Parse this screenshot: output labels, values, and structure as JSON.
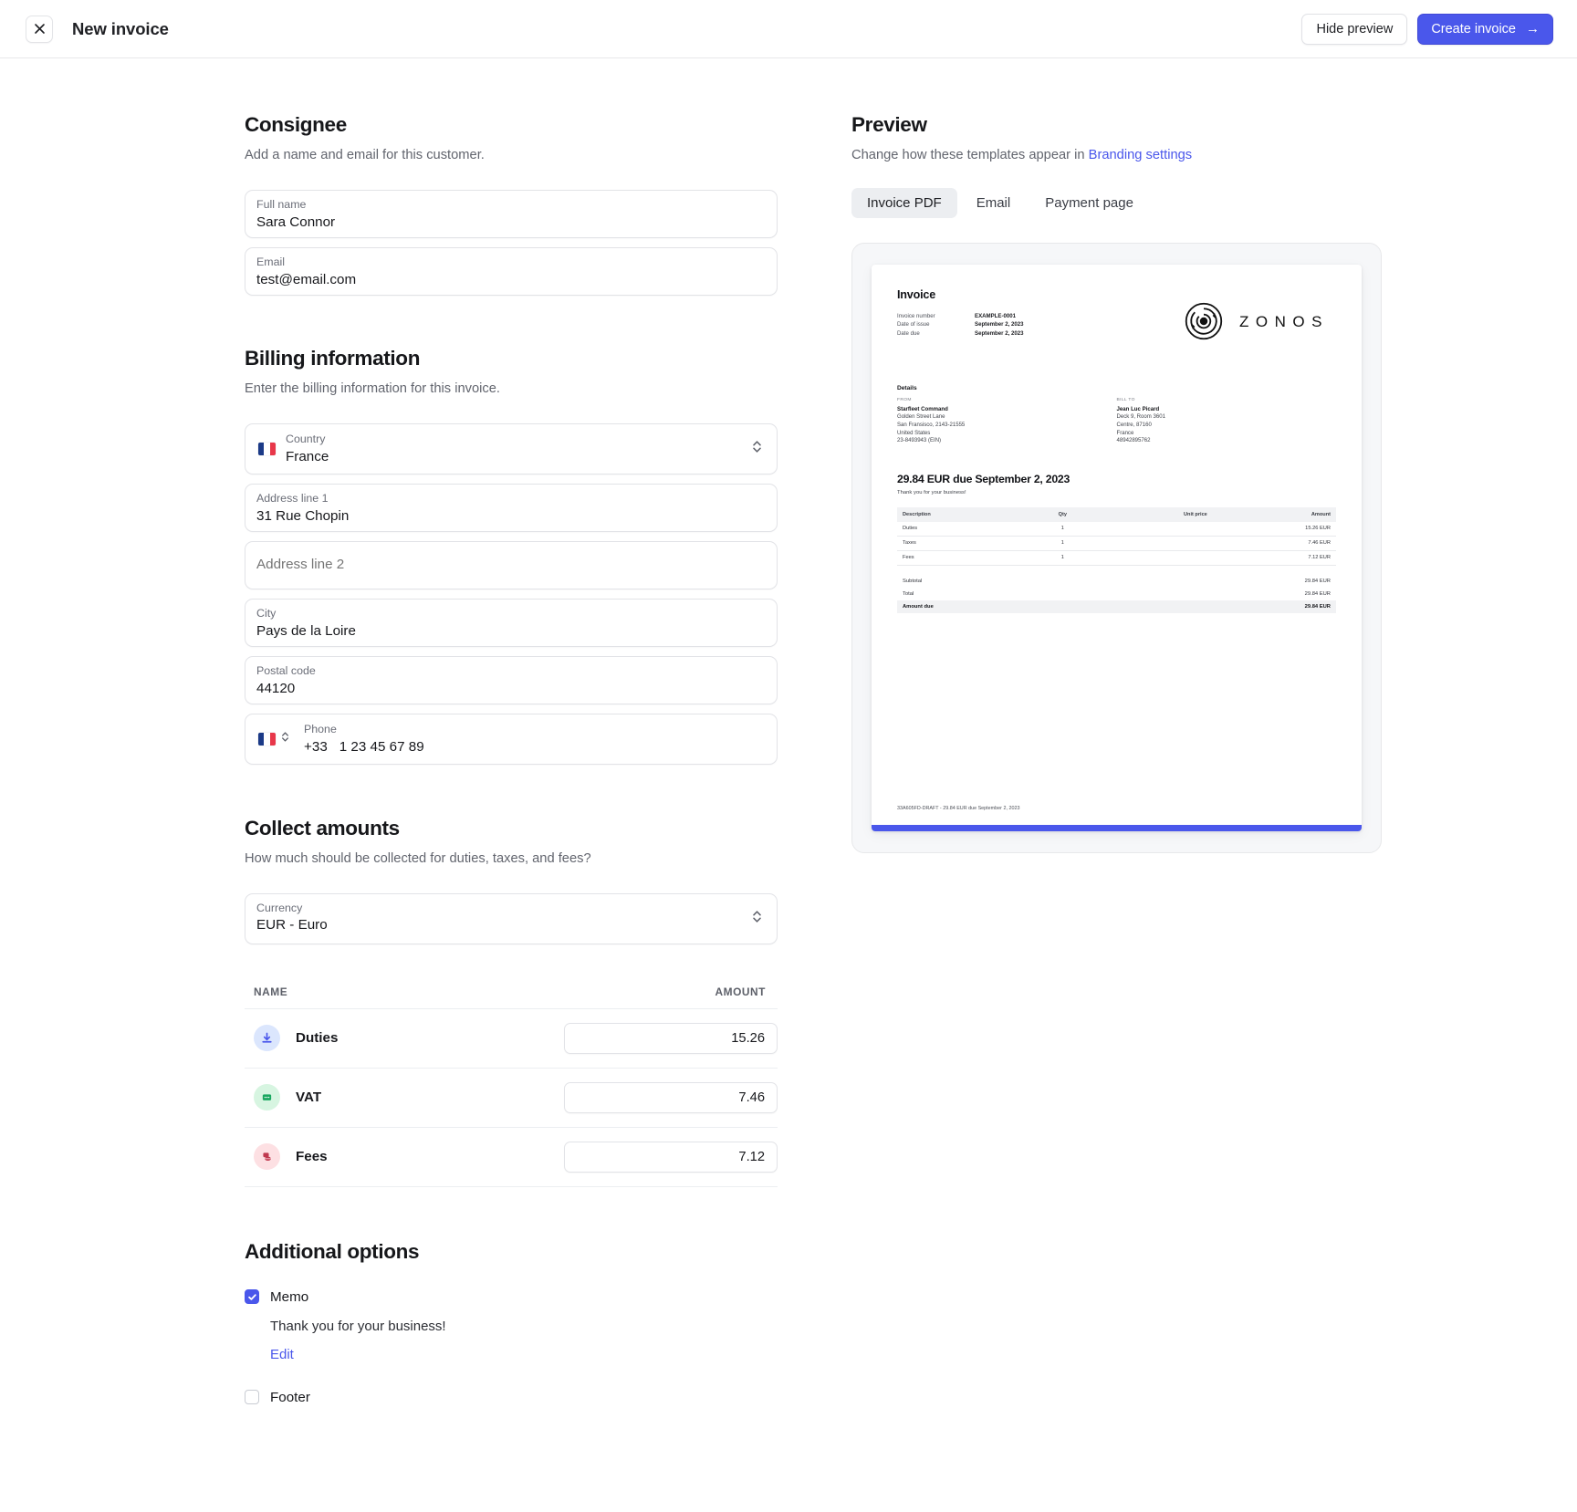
{
  "topbar": {
    "close_icon": "close-icon",
    "title": "New invoice",
    "hide_preview_label": "Hide preview",
    "create_invoice_label": "Create invoice",
    "create_invoice_arrow": "→",
    "primary_color": "#4a57eb"
  },
  "consignee": {
    "title": "Consignee",
    "subtitle": "Add a name and email for this customer.",
    "full_name": {
      "label": "Full name",
      "value": "Sara Connor"
    },
    "email": {
      "label": "Email",
      "value": "test@email.com"
    }
  },
  "billing": {
    "title": "Billing information",
    "subtitle": "Enter the billing information for this invoice.",
    "country": {
      "label": "Country",
      "value": "France",
      "flag": "fr-flag-icon"
    },
    "address1": {
      "label": "Address line 1",
      "value": "31 Rue Chopin"
    },
    "address2": {
      "label": "Address line 2",
      "placeholder": "Address line 2",
      "value": ""
    },
    "city": {
      "label": "City",
      "value": "Pays de la Loire"
    },
    "postal": {
      "label": "Postal code",
      "value": "44120"
    },
    "phone": {
      "label": "Phone",
      "dial_code": "+33",
      "value": "1 23 45 67 89",
      "flag": "fr-flag-icon"
    }
  },
  "collect": {
    "title": "Collect amounts",
    "subtitle": "How much should be collected for duties, taxes, and fees?",
    "currency": {
      "label": "Currency",
      "value": "EUR - Euro"
    },
    "columns": {
      "name": "NAME",
      "amount": "AMOUNT"
    },
    "rows": [
      {
        "name": "Duties",
        "amount": "15.26",
        "icon": "duties-download-icon",
        "icon_bg": "#dbe6fd",
        "icon_fg": "#4a57eb"
      },
      {
        "name": "VAT",
        "amount": "7.46",
        "icon": "vat-receipt-icon",
        "icon_bg": "#d7f5e1",
        "icon_fg": "#1aa860"
      },
      {
        "name": "Fees",
        "amount": "7.12",
        "icon": "fees-coins-icon",
        "icon_bg": "#fde0e3",
        "icon_fg": "#c0394f"
      }
    ]
  },
  "additional": {
    "title": "Additional options",
    "memo": {
      "label": "Memo",
      "checked": true,
      "text": "Thank you for your business!",
      "edit_label": "Edit"
    },
    "footer": {
      "label": "Footer",
      "checked": false
    }
  },
  "preview": {
    "title": "Preview",
    "subtitle_prefix": "Change how these templates appear in ",
    "subtitle_link": "Branding settings",
    "tabs": [
      {
        "label": "Invoice PDF",
        "active": true
      },
      {
        "label": "Email",
        "active": false
      },
      {
        "label": "Payment page",
        "active": false
      }
    ]
  },
  "invoice_doc": {
    "heading": "Invoice",
    "meta": [
      {
        "key": "Invoice number",
        "value": "EXAMPLE-0001"
      },
      {
        "key": "Date of issue",
        "value": "September 2, 2023"
      },
      {
        "key": "Date due",
        "value": "September 2, 2023"
      }
    ],
    "brand_name": "ZONOS",
    "details_heading": "Details",
    "from": {
      "kicker": "FROM",
      "name": "Starfleet Command",
      "lines": [
        "Golden Street Lane",
        "San Fransisco, 2143-21555",
        "United States",
        "23-8493943 (EIN)"
      ]
    },
    "bill_to": {
      "kicker": "BILL TO",
      "name": "Jean Luc Picard",
      "lines": [
        "Deck 9, Room 3601",
        "Centre, 87160",
        "France",
        "48942895762"
      ]
    },
    "due_title": "29.84 EUR due September 2, 2023",
    "memo": "Thank you for your business!",
    "table": {
      "headers": [
        "Description",
        "Qty",
        "Unit price",
        "Amount"
      ],
      "rows": [
        {
          "description": "Duties",
          "qty": "1",
          "unit_price": "",
          "amount": "15.26 EUR"
        },
        {
          "description": "Taxes",
          "qty": "1",
          "unit_price": "",
          "amount": "7.46 EUR"
        },
        {
          "description": "Fees",
          "qty": "1",
          "unit_price": "",
          "amount": "7.12 EUR"
        }
      ]
    },
    "totals": [
      {
        "label": "Subtotal",
        "value": "29.84 EUR",
        "emphasis": false
      },
      {
        "label": "Total",
        "value": "29.84 EUR",
        "emphasis": false
      },
      {
        "label": "Amount due",
        "value": "29.84 EUR",
        "emphasis": true
      }
    ],
    "footer_text": "33A605FD-DRAFT - 29.84 EUR due September 2, 2023",
    "accent_color": "#4a57eb"
  }
}
